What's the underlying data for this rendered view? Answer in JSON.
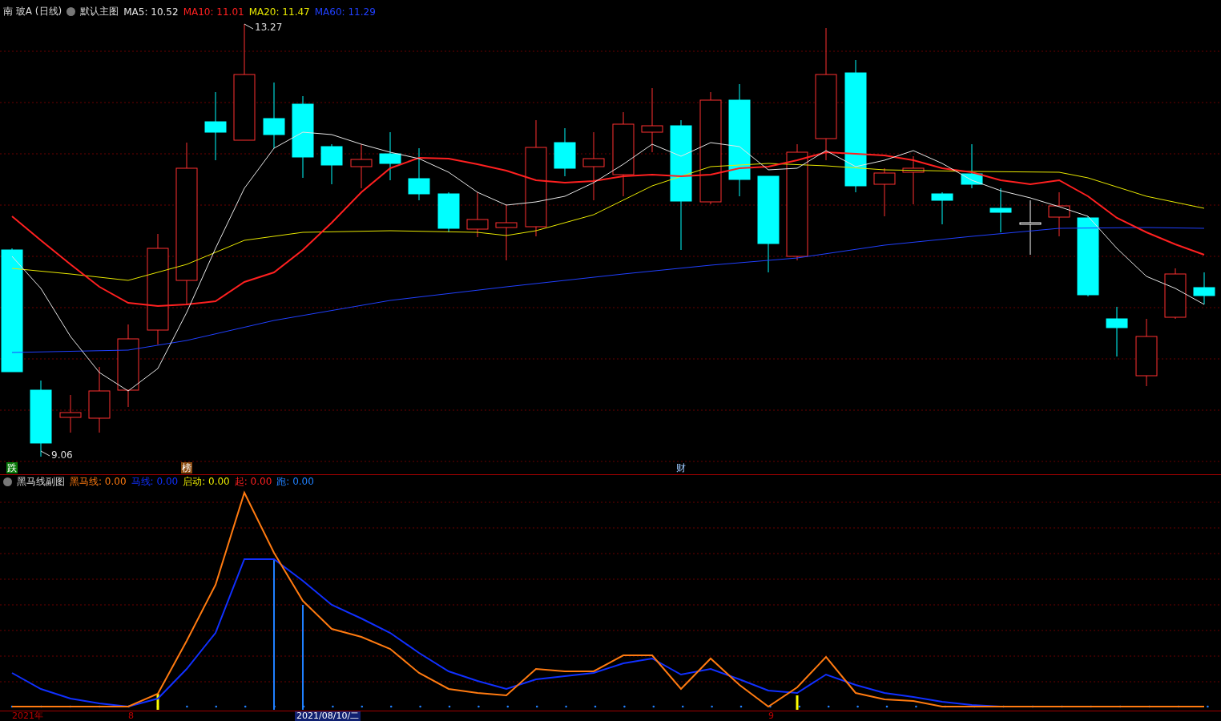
{
  "main_chart": {
    "title": "南 玻A (日线)",
    "template": "默认主图",
    "indicators": [
      {
        "label": "MA5: 10.52",
        "color": "#e6e6e6"
      },
      {
        "label": "MA10: 11.01",
        "color": "#ff2020"
      },
      {
        "label": "MA20: 11.47",
        "color": "#e8e800"
      },
      {
        "label": "MA60: 11.29",
        "color": "#2040ff"
      }
    ],
    "high_label": "13.27",
    "low_label": "9.06",
    "event_marks": [
      {
        "label": "跌",
        "kind": "fall"
      },
      {
        "label": "榜",
        "kind": "rank"
      },
      {
        "label": "财",
        "kind": "finance"
      }
    ]
  },
  "sub_chart": {
    "title": "黑马线副图",
    "indicators": [
      {
        "label": "黑马线: 0.00",
        "color": "#ff7a10"
      },
      {
        "label": "马线: 0.00",
        "color": "#1030ff"
      },
      {
        "label": "启动: 0.00",
        "color": "#e8e800"
      },
      {
        "label": "起: 0.00",
        "color": "#ff2020"
      },
      {
        "label": "跑: 0.00",
        "color": "#2080ff"
      }
    ]
  },
  "time_axis": {
    "labels": [
      "2021年",
      "8",
      "9"
    ],
    "cursor_date": "2021/08/10/二"
  }
}
